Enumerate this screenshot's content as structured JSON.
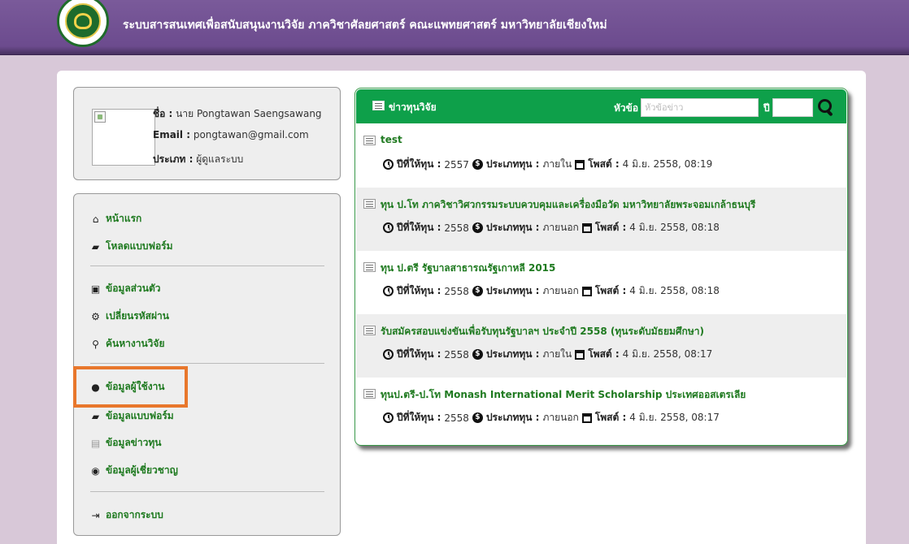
{
  "header": {
    "title": "ระบบสารสนเทศเพื่อสนับสนุนงานวิจัย ภาควิชาศัลยศาสตร์ คณะแพทยศาสตร์ มหาวิทยาลัยเชียงใหม่"
  },
  "profile": {
    "name_label": "ชื่อ :",
    "name_value": "นาย Pongtawan Saengsawang",
    "email_label": "Email :",
    "email_value": "pongtawan@gmail.com",
    "type_label": "ประเภท :",
    "type_value": "ผู้ดูแลระบบ"
  },
  "menu": {
    "items": [
      {
        "label": "หน้าแรก",
        "icon": "home-icon"
      },
      {
        "label": "โหลดแบบฟอร์ม",
        "icon": "folder-open-icon"
      },
      {
        "label": "ข้อมูลส่วนตัว",
        "icon": "id-card-icon"
      },
      {
        "label": "เปลี่ยนรหัสผ่าน",
        "icon": "cogs-icon"
      },
      {
        "label": "ค้นหางานวิจัย",
        "icon": "search-icon"
      },
      {
        "label": "ข้อมูลผู้ใช้งาน",
        "icon": "users-icon"
      },
      {
        "label": "ข้อมูลแบบฟอร์ม",
        "icon": "folder-open-icon"
      },
      {
        "label": "ข้อมูลข่าวทุน",
        "icon": "newspaper-icon"
      },
      {
        "label": "ข้อมูลผู้เชี่ยวชาญ",
        "icon": "expert-icon"
      },
      {
        "label": "ออกจากระบบ",
        "icon": "logout-icon"
      }
    ]
  },
  "news": {
    "title": "ข่าวทุนวิจัย",
    "topic_label": "หัวข้อ",
    "topic_placeholder": "หัวข้อข่าว",
    "year_label": "ปี",
    "items": [
      {
        "title": "test",
        "year_label": "ปีที่ให้ทุน :",
        "year": "2557",
        "type_label": "ประเภททุน :",
        "type": "ภายใน",
        "post_label": "โพสต์ :",
        "posted": "4 มิ.ย. 2558, 08:19"
      },
      {
        "title": "ทุน ป.โท ภาควิชาวิศวกรรมระบบควบคุมและเครื่องมือวัด มหาวิทยาลัยพระจอมเกล้าธนบุรี",
        "year_label": "ปีที่ให้ทุน :",
        "year": "2558",
        "type_label": "ประเภททุน :",
        "type": "ภายนอก",
        "post_label": "โพสต์ :",
        "posted": "4 มิ.ย. 2558, 08:18"
      },
      {
        "title": "ทุน ป.ตรี รัฐบาลสาธารณรัฐเกาหลี 2015",
        "year_label": "ปีที่ให้ทุน :",
        "year": "2558",
        "type_label": "ประเภททุน :",
        "type": "ภายนอก",
        "post_label": "โพสต์ :",
        "posted": "4 มิ.ย. 2558, 08:18"
      },
      {
        "title": "รับสมัครสอบแข่งขันเพื่อรับทุนรัฐบาลฯ ประจำปี 2558 (ทุนระดับมัธยมศึกษา)",
        "year_label": "ปีที่ให้ทุน :",
        "year": "2558",
        "type_label": "ประเภททุน :",
        "type": "ภายใน",
        "post_label": "โพสต์ :",
        "posted": "4 มิ.ย. 2558, 08:17"
      },
      {
        "title": "ทุนป.ตรี-ป.โท Monash International Merit Scholarship ประเทศออสเตรเลีย",
        "year_label": "ปีที่ให้ทุน :",
        "year": "2558",
        "type_label": "ประเภททุน :",
        "type": "ภายนอก",
        "post_label": "โพสต์ :",
        "posted": "4 มิ.ย. 2558, 08:17"
      }
    ]
  },
  "colors": {
    "header_purple": "#6c4b8e",
    "link_green": "#1f7a20",
    "news_header_green": "#0ea04a",
    "highlight_orange": "#e8772c"
  }
}
